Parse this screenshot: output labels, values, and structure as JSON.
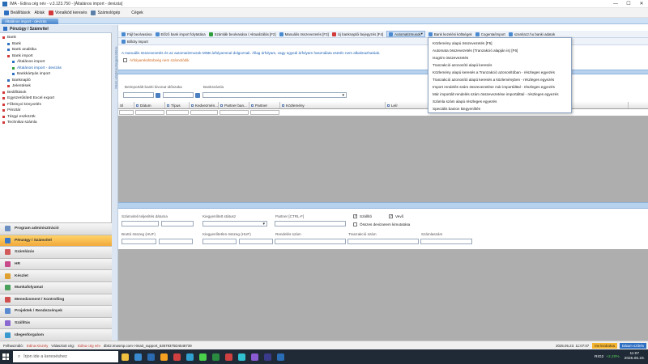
{
  "window": {
    "title": "IMA - Edina cég név - v.3.123.750 - [Általános import - devizás]",
    "controls": [
      "—",
      "☐",
      "✕"
    ]
  },
  "menubar": {
    "items": [
      {
        "label": "Beállítások",
        "color": "#2e6fc2"
      },
      {
        "label": "Ablak",
        "color": ""
      },
      {
        "label": "Vonalkód keresés",
        "color": "#d23a3a"
      },
      {
        "label": "Számológép",
        "color": "#5a7fa8"
      },
      {
        "label": "Cégek",
        "color": ""
      }
    ]
  },
  "module_tab": "Általános import - devizás",
  "left_panel": {
    "header": "Pénzügy / Számvitel",
    "tree": [
      {
        "label": "Bank",
        "indent": 0,
        "icon": "sq-red"
      },
      {
        "label": "Bank",
        "indent": 1,
        "icon": "sq-blue"
      },
      {
        "label": "Bank analitika",
        "indent": 1,
        "icon": "sq-blue"
      },
      {
        "label": "Bank import",
        "indent": 1,
        "icon": "sq-red"
      },
      {
        "label": "Általános import",
        "indent": 2,
        "icon": "sq-blue"
      },
      {
        "label": "Általános import - devizás",
        "indent": 2,
        "icon": "sq-green",
        "selected": true
      },
      {
        "label": "Bankkártyás import",
        "indent": 2,
        "icon": "sq-blue"
      },
      {
        "label": "Banknapló",
        "indent": 1,
        "icon": "sq-blue"
      },
      {
        "label": "Jelentések",
        "indent": 1,
        "icon": "sq-red"
      },
      {
        "label": "Beállítások",
        "indent": 0,
        "icon": "sq-red"
      },
      {
        "label": "Egyszerűsített Excel export",
        "indent": 0,
        "icon": "sq-red"
      },
      {
        "label": "Főkönyvi könyvelés",
        "indent": 0,
        "icon": "sq-red"
      },
      {
        "label": "Pénztár",
        "indent": 0,
        "icon": "sq-red"
      },
      {
        "label": "Tárgyi eszközök",
        "indent": 0,
        "icon": "sq-red"
      },
      {
        "label": "Technikai számla",
        "indent": 0,
        "icon": "sq-red"
      }
    ],
    "modules": [
      {
        "label": "Program adminisztráció",
        "color": "#6a8fc0",
        "active": false
      },
      {
        "label": "Pénzügy / Számvitel",
        "color": "#3a78c8",
        "active": true
      },
      {
        "label": "Számlázás",
        "color": "#d35a5a",
        "active": false
      },
      {
        "label": "HR",
        "color": "#c84a8a",
        "active": false
      },
      {
        "label": "Készlet",
        "color": "#e0a030",
        "active": false
      },
      {
        "label": "Munkafolyamat",
        "color": "#4aa05a",
        "active": false
      },
      {
        "label": "Menedzsment / Kontrolling",
        "color": "#d05050",
        "active": false
      },
      {
        "label": "Projektek / Rendezvények",
        "color": "#5a8ad0",
        "active": false
      },
      {
        "label": "Szállítás",
        "color": "#8a6ad0",
        "active": false
      },
      {
        "label": "Idegenforgalom",
        "color": "#3a9ad0",
        "active": false
      }
    ]
  },
  "vertical_strip": "Menü elrejtése/megjelenítése",
  "toolbar": {
    "items": [
      {
        "label": "Fájl beolvasása",
        "color": "#4a8ad0"
      },
      {
        "label": "Előző bank import folytatása",
        "color": "#4a8ad0"
      },
      {
        "label": "Számlák beolvasása / Aktualizálás [F2]",
        "color": "#2f9d3a"
      },
      {
        "label": "Manuális összevezetés [F3]",
        "color": "#4a8ad0"
      },
      {
        "label": "Új banknaplói bejegyzés [F4]",
        "color": "#d23a3a"
      },
      {
        "label": "Automatizmusok",
        "color": "#4a8ad0",
        "active": true
      },
      {
        "label": "Bank kezelési költségek",
        "color": "#4a8ad0"
      },
      {
        "label": "Cogenta/import",
        "color": "#4a8ad0"
      },
      {
        "label": "szamlazz.hu banki adatok",
        "color": "#4a8ad0"
      }
    ],
    "second_row": "Billcity import"
  },
  "info": {
    "message": "A manuális összevezetés és az automatizmusok MNB árfolyammal dolgoznak. Állag árfolyam, vagy egyedi árfolyam használata esetén nem alkalmazhatóak.",
    "checkbox_label": "Árfolyamkülönbség nem számolódik"
  },
  "filters": {
    "date_label": "Beimportált banki kivonat időszaka",
    "account_label": "Bankszámla"
  },
  "grid": {
    "columns": [
      "Dátum",
      "Típus",
      "Kedvezmén...",
      "Partner ban...",
      "Partner",
      "Közlemény",
      "Leír"
    ]
  },
  "detail": {
    "fields": {
      "date_label": "Számviteli teljesítés dátuma",
      "status_label": "Kiegyenlített státusz",
      "partner_label": "Partner [CTRL-F]",
      "supplier_label": "Szállító",
      "buyer_label": "Vevő",
      "all_currency_label": "Összes devizanem kimutatása",
      "gross_label": "Bruttó összeg (HUF)",
      "settled_label": "Kiegyenlítetlen összeg (HUF)",
      "order_label": "Rendelés szám",
      "transaction_label": "Tranzakció szám",
      "invoice_label": "Számlaszám"
    }
  },
  "dropdown": {
    "items": [
      "Közlemény alapú összevezetés [F5]",
      "Automata összevezetés (Tranzakció alapján is) [F6]",
      "Isogrim összevezetés",
      "Tranzakció azonosító alapú keresés",
      "Közlemény alapú keresés a Tranzakció azonosítóban - részleges egyezés",
      "Tranzakció azonosító alapú keresés a közleményben - részleges egyezés",
      "Import rendelés szám összevezetése már importálttal - részleges egyezés",
      "Már importált rendelés szám összevezetése importálttal - részleges egyezés",
      "Számla szám alapú részleges egyezés",
      "Speciális banion kiegyenlítés"
    ]
  },
  "statusbar": {
    "user_label": "Felhasználó:",
    "user": "Edina Kiszely",
    "company_label": "Választott cég:",
    "company": "Edina cég név",
    "db": "db02.imasrsp.com->ima3_support_63679375D4548739",
    "timestamp": "2025.05.23. 11:07:07",
    "badge_orange": "Inv lezárolva",
    "badge_blue": "Dátum szűrés"
  },
  "taskbar": {
    "search_placeholder": "Írjon ide a kereséshez",
    "apps": [
      "#f0c040",
      "#3a8ad0",
      "#2a6ab0",
      "#f5a020",
      "#d04040",
      "#30a0d0",
      "#4ad04a",
      "#2a8a40",
      "#d04040",
      "#30c0d0",
      "#8a5ad0",
      "#3a3a8a",
      "#2a6db5"
    ],
    "weather": "RIG2",
    "index": "+2,20%",
    "time": "11:07",
    "date": "2025.05.23."
  }
}
